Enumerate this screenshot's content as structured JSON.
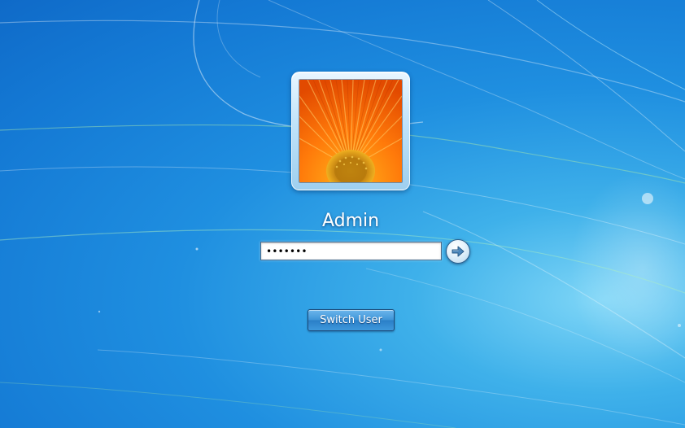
{
  "background": {
    "description_colors": [
      "#0f6ac8",
      "#1f8fe0",
      "#7fd6f7"
    ]
  },
  "user": {
    "name": "Admin",
    "avatar": "orange-gerbera-flower"
  },
  "password": {
    "value": "•••••••",
    "masked": true
  },
  "submit": {
    "icon": "arrow-right-icon"
  },
  "switch_user": {
    "label": "Switch User"
  },
  "colors": {
    "accent": "#1f8fe0",
    "button": "#3f95d8"
  }
}
